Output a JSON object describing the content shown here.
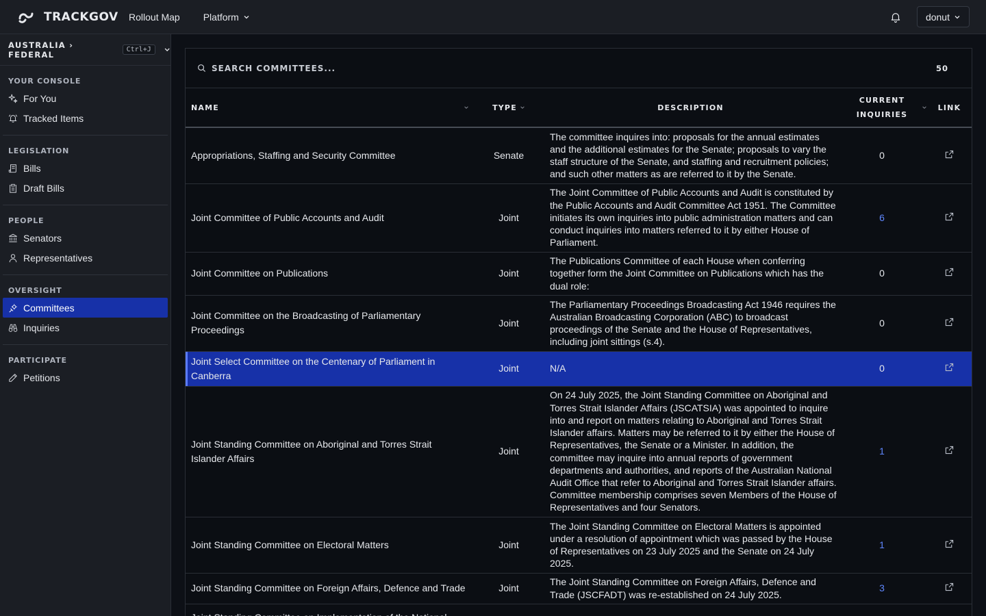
{
  "app": {
    "name": "TRACKGOV"
  },
  "topnav": {
    "items": [
      {
        "label": "Rollout Map"
      },
      {
        "label": "Platform"
      }
    ],
    "user": "donut"
  },
  "sidebar": {
    "jurisdiction": "AUSTRALIA › FEDERAL",
    "shortcut": "Ctrl+J",
    "sections": [
      {
        "title": "YOUR CONSOLE",
        "items": [
          {
            "label": "For You",
            "icon": "sparkle-icon"
          },
          {
            "label": "Tracked Items",
            "icon": "bell-ring-icon"
          }
        ]
      },
      {
        "title": "LEGISLATION",
        "items": [
          {
            "label": "Bills",
            "icon": "scroll-icon"
          },
          {
            "label": "Draft Bills",
            "icon": "clipboard-icon"
          }
        ]
      },
      {
        "title": "PEOPLE",
        "items": [
          {
            "label": "Senators",
            "icon": "landmark-icon"
          },
          {
            "label": "Representatives",
            "icon": "user-icon"
          }
        ]
      },
      {
        "title": "OVERSIGHT",
        "items": [
          {
            "label": "Committees",
            "icon": "cog-group-icon",
            "active": true
          },
          {
            "label": "Inquiries",
            "icon": "binoculars-icon"
          }
        ]
      },
      {
        "title": "PARTICIPATE",
        "items": [
          {
            "label": "Petitions",
            "icon": "pen-icon"
          }
        ]
      }
    ]
  },
  "search": {
    "placeholder": "SEARCH COMMITTEES...",
    "page_size": "50"
  },
  "table": {
    "headers": {
      "name": "NAME",
      "type": "TYPE",
      "description": "DESCRIPTION",
      "inquiries_1": "CURRENT",
      "inquiries_2": "INQUIRIES",
      "link": "LINK"
    },
    "rows": [
      {
        "name": "Appropriations, Staffing and Security Committee",
        "type": "Senate",
        "description": "The committee inquires into: proposals for the annual estimates and the additional estimates for the Senate; proposals to vary the staff structure of the Senate, and staffing and recruitment policies; and such other matters as are referred to it by the Senate.",
        "inquiries": "0",
        "height": 82
      },
      {
        "name": "Joint Committee of Public Accounts and Audit",
        "type": "Joint",
        "description": "The Joint Committee of Public Accounts and Audit is constituted by the Public Accounts and Audit Committee Act 1951. The Committee initiates its own inquiries into public administration matters and can conduct inquiries into matters referred to it by either House of Parliament.",
        "inquiries": "6",
        "height": 100
      },
      {
        "name": "Joint Committee on Publications",
        "type": "Joint",
        "description": "The Publications Committee of each House when conferring together form the Joint Committee on Publications which has the dual role:",
        "inquiries": "0",
        "height": 63
      },
      {
        "name": "Joint Committee on the Broadcasting of Parliamentary Proceedings",
        "type": "Joint",
        "description": "The Parliamentary Proceedings Broadcasting Act 1946 requires the Australian Broadcasting Corporation (ABC) to broadcast proceedings of the Senate and the House of Representatives, including joint sittings (s.4).",
        "inquiries": "0",
        "height": 82
      },
      {
        "name": "Joint Select Committee on the Centenary of Parliament in Canberra",
        "type": "Joint",
        "description": "N/A",
        "inquiries": "0",
        "height": 51,
        "selected": true
      },
      {
        "name": "Joint Standing Committee on Aboriginal and Torres Strait Islander Affairs",
        "type": "Joint",
        "description": "On 24 July 2025, the Joint Standing Committee on Aboriginal and Torres Strait Islander Affairs (JSCATSIA) was appointed to inquire into and report on matters relating to Aboriginal and Torres Strait Islander affairs. Matters may be referred to it by either the House of Representatives, the Senate or a Minister. In addition, the committee may inquire into annual reports of government departments and authorities, and reports of the Australian National Audit Office that refer to Aboriginal and Torres Strait Islander affairs. Committee membership comprises seven Members of the House of Representatives and four Senators.",
        "inquiries": "1",
        "height": 191
      },
      {
        "name": "Joint Standing Committee on Electoral Matters",
        "type": "Joint",
        "description": "The Joint Standing Committee on Electoral Matters is appointed under a resolution of appointment which was passed by the House of Representatives on 23 July 2025 and the Senate on 24 July 2025.",
        "inquiries": "1",
        "height": 82
      },
      {
        "name": "Joint Standing Committee on Foreign Affairs, Defence and Trade",
        "type": "Joint",
        "description": "The Joint Standing Committee on Foreign Affairs, Defence and Trade (JSCFADT) was re-established on 24 July 2025.",
        "inquiries": "3",
        "height": 45
      },
      {
        "name": "Joint Standing Committee on Implementation of the National",
        "type": "",
        "description": "",
        "inquiries": "",
        "height": 40
      }
    ]
  }
}
